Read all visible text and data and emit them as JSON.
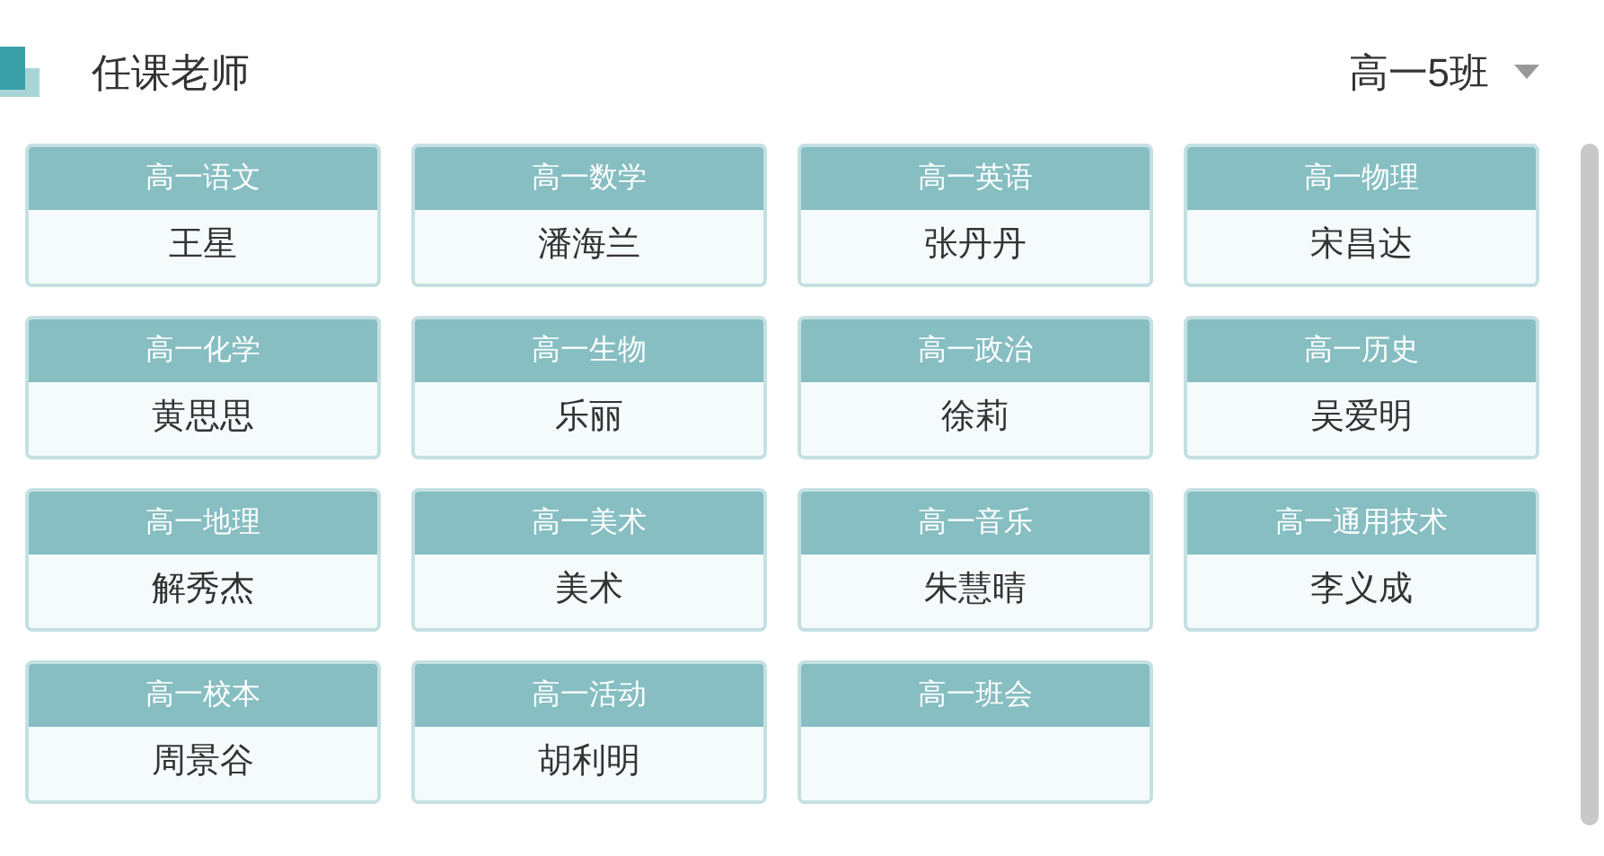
{
  "title": "任课老师",
  "class_select": {
    "value": "高一5班"
  },
  "courses": [
    {
      "subject": "高一语文",
      "teacher": "王星"
    },
    {
      "subject": "高一数学",
      "teacher": "潘海兰"
    },
    {
      "subject": "高一英语",
      "teacher": "张丹丹"
    },
    {
      "subject": "高一物理",
      "teacher": "宋昌达"
    },
    {
      "subject": "高一化学",
      "teacher": "黄思思"
    },
    {
      "subject": "高一生物",
      "teacher": "乐丽"
    },
    {
      "subject": "高一政治",
      "teacher": "徐莉"
    },
    {
      "subject": "高一历史",
      "teacher": "吴爱明"
    },
    {
      "subject": "高一地理",
      "teacher": "解秀杰"
    },
    {
      "subject": "高一美术",
      "teacher": "美术"
    },
    {
      "subject": "高一音乐",
      "teacher": "朱慧晴"
    },
    {
      "subject": "高一通用技术",
      "teacher": "李义成"
    },
    {
      "subject": "高一校本",
      "teacher": "周景谷"
    },
    {
      "subject": "高一活动",
      "teacher": "胡利明"
    },
    {
      "subject": "高一班会"
    }
  ]
}
